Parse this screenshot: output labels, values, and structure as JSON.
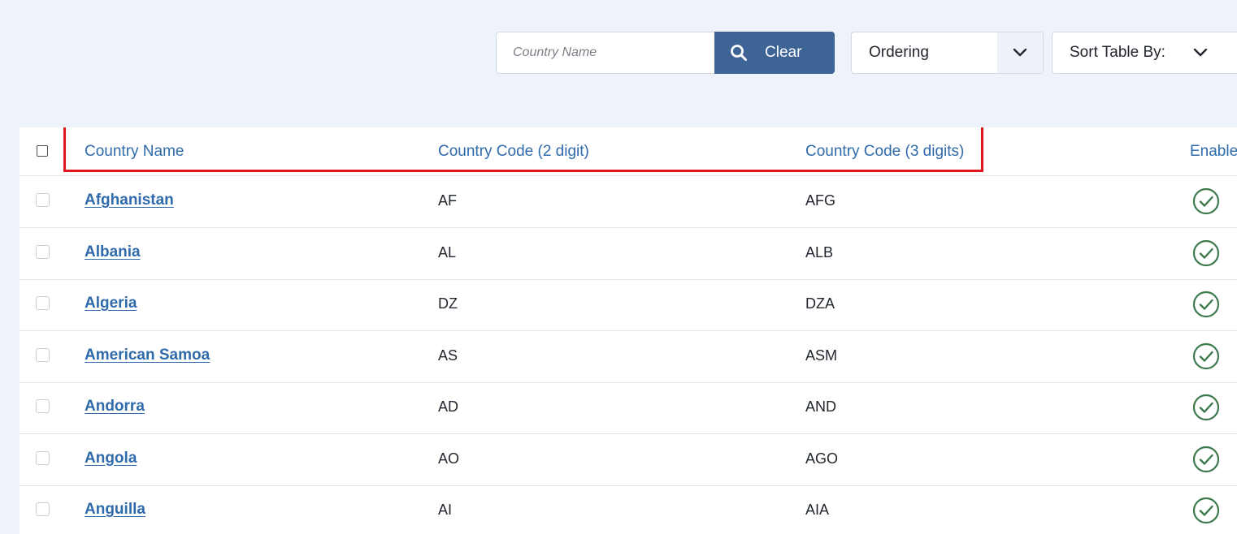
{
  "toolbar": {
    "search_placeholder": "Country Name",
    "search_icon": "search-icon",
    "clear_label": "Clear",
    "ordering_label": "Ordering",
    "sort_label": "Sort Table By:"
  },
  "table": {
    "columns": {
      "name": "Country Name",
      "code2": "Country Code (2 digit)",
      "code3": "Country Code (3 digits)",
      "enabled": "Enable"
    },
    "rows": [
      {
        "name": "Afghanistan",
        "code2": "AF",
        "code3": "AFG",
        "enabled": true
      },
      {
        "name": "Albania",
        "code2": "AL",
        "code3": "ALB",
        "enabled": true
      },
      {
        "name": "Algeria",
        "code2": "DZ",
        "code3": "DZA",
        "enabled": true
      },
      {
        "name": "American Samoa",
        "code2": "AS",
        "code3": "ASM",
        "enabled": true
      },
      {
        "name": "Andorra",
        "code2": "AD",
        "code3": "AND",
        "enabled": true
      },
      {
        "name": "Angola",
        "code2": "AO",
        "code3": "AGO",
        "enabled": true
      },
      {
        "name": "Anguilla",
        "code2": "AI",
        "code3": "AIA",
        "enabled": true
      }
    ]
  },
  "colors": {
    "accent": "#3d6494",
    "link": "#2f6aab",
    "enabled_check": "#3d7a4e",
    "highlight": "#e0161d"
  }
}
